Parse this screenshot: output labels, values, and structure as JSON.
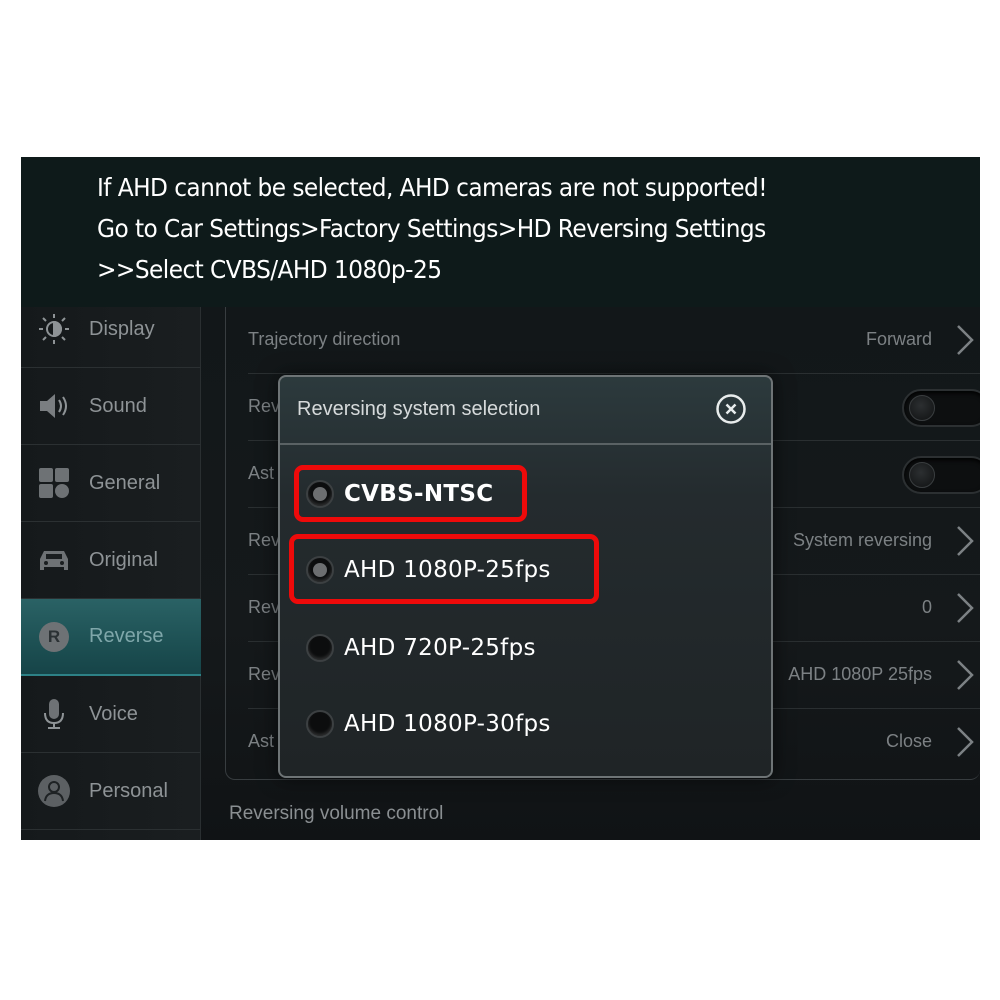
{
  "banner": {
    "lines": [
      "If AHD cannot be selected, AHD cameras are not supported!",
      "Go to Car Settings>Factory Settings>HD Reversing Settings",
      ">>Select CVBS/AHD 1080p-25"
    ]
  },
  "sidebar": {
    "items": [
      {
        "label": "Display",
        "icon": "brightness-icon"
      },
      {
        "label": "Sound",
        "icon": "speaker-icon"
      },
      {
        "label": "General",
        "icon": "grid-icon"
      },
      {
        "label": "Original",
        "icon": "car-icon"
      },
      {
        "label": "Reverse",
        "icon": "reverse-r-icon",
        "active": true
      },
      {
        "label": "Voice",
        "icon": "microphone-icon"
      },
      {
        "label": "Personal",
        "icon": "person-icon"
      }
    ],
    "reverse_badge": "R"
  },
  "settings": {
    "rows": [
      {
        "label": "Trajectory direction",
        "value": "Forward",
        "control": "chevron"
      },
      {
        "label": "Rev",
        "value": "",
        "control": "toggle",
        "toggle_on": false
      },
      {
        "label": "Ast",
        "value": "",
        "control": "toggle",
        "toggle_on": false
      },
      {
        "label": "Rev",
        "value": "System reversing",
        "control": "chevron"
      },
      {
        "label": "Rev",
        "value": "0",
        "control": "chevron"
      },
      {
        "label": "Rev",
        "value": "AHD 1080P 25fps",
        "control": "chevron"
      },
      {
        "label": "Ast",
        "value": "Close",
        "control": "chevron"
      }
    ],
    "section_label": "Reversing volume control"
  },
  "dialog": {
    "title": "Reversing system selection",
    "close_icon": "close-circle-icon",
    "options": [
      {
        "label": "CVBS-NTSC",
        "highlighted": true
      },
      {
        "label": "AHD 1080P-25fps",
        "highlighted": true
      },
      {
        "label": "AHD 720P-25fps",
        "highlighted": false
      },
      {
        "label": "AHD 1080P-30fps",
        "highlighted": false
      }
    ]
  },
  "colors": {
    "highlight": "#ee0a0a",
    "active_tab": "#1d5053",
    "banner_bg": "#0e1a1a"
  }
}
